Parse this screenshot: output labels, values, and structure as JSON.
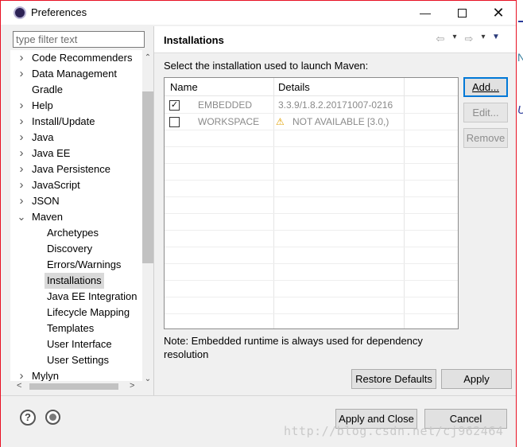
{
  "window": {
    "title": "Preferences",
    "min_glyph": "—",
    "close_glyph": "✕"
  },
  "filter": {
    "placeholder": "type filter text"
  },
  "tree": {
    "items": [
      {
        "label": "Code Recommenders",
        "expandable": true
      },
      {
        "label": "Data Management",
        "expandable": true
      },
      {
        "label": "Gradle",
        "expandable": false
      },
      {
        "label": "Help",
        "expandable": true
      },
      {
        "label": "Install/Update",
        "expandable": true
      },
      {
        "label": "Java",
        "expandable": true
      },
      {
        "label": "Java EE",
        "expandable": true
      },
      {
        "label": "Java Persistence",
        "expandable": true
      },
      {
        "label": "JavaScript",
        "expandable": true
      },
      {
        "label": "JSON",
        "expandable": true
      },
      {
        "label": "Maven",
        "expandable": true,
        "expanded": true
      },
      {
        "label": "Archetypes",
        "child": true
      },
      {
        "label": "Discovery",
        "child": true
      },
      {
        "label": "Errors/Warnings",
        "child": true
      },
      {
        "label": "Installations",
        "child": true,
        "selected": true
      },
      {
        "label": "Java EE Integration",
        "child": true
      },
      {
        "label": "Lifecycle Mapping",
        "child": true
      },
      {
        "label": "Templates",
        "child": true
      },
      {
        "label": "User Interface",
        "child": true
      },
      {
        "label": "User Settings",
        "child": true
      },
      {
        "label": "Mylyn",
        "expandable": true
      }
    ]
  },
  "page": {
    "title": "Installations",
    "prompt": "Select the installation used to launch Maven:",
    "nav": {
      "back": "⇦",
      "forward": "⇨",
      "dropdown": "▾",
      "menu": "▼"
    }
  },
  "installations": {
    "headers": [
      "Name",
      "Details"
    ],
    "rows": [
      {
        "checked": true,
        "name": "EMBEDDED",
        "details": "3.3.9/1.8.2.20171007-0216",
        "warning": false
      },
      {
        "checked": false,
        "name": "WORKSPACE",
        "details": "NOT AVAILABLE [3.0,)",
        "warning": true
      }
    ]
  },
  "buttons": {
    "add": "Add...",
    "edit": "Edit...",
    "remove": "Remove",
    "restore_defaults": "Restore Defaults",
    "apply": "Apply",
    "apply_and_close": "Apply and Close",
    "cancel": "Cancel"
  },
  "note": "Note: Embedded runtime is always used for dependency resolution",
  "icons": {
    "help": "?",
    "check": "✓",
    "warning": "⚠"
  },
  "watermark": "http://blog.csdn.net/cj962464",
  "colors": {
    "selection": "#cce8ff",
    "focus_border": "#0078d7",
    "warning": "#e0a000"
  }
}
